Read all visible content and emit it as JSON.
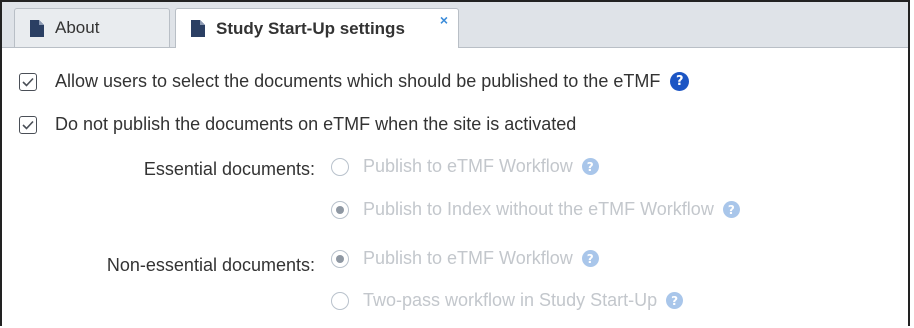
{
  "tabs": [
    {
      "label": "About",
      "icon": "document-icon",
      "active": false
    },
    {
      "label": "Study Start-Up settings",
      "icon": "document-icon",
      "active": true,
      "close_glyph": "×"
    }
  ],
  "options": {
    "allow_select": {
      "label": "Allow users to select the documents which should be published to the eTMF",
      "checked": true
    },
    "do_not_publish": {
      "label": "Do not publish the documents on eTMF when the site is activated",
      "checked": true
    }
  },
  "essential": {
    "label": "Essential documents:",
    "choices": [
      {
        "label": "Publish to eTMF Workflow",
        "selected": false
      },
      {
        "label": "Publish to Index without the eTMF Workflow",
        "selected": true
      }
    ]
  },
  "non_essential": {
    "label": "Non-essential documents:",
    "choices": [
      {
        "label": "Publish to eTMF Workflow",
        "selected": true
      },
      {
        "label": "Two-pass workflow in Study Start-Up",
        "selected": false
      }
    ]
  },
  "help_glyph": "?",
  "colors": {
    "accent": "#1c55c4",
    "help_disabled": "#a9c6ea",
    "tab_close": "#3a8bd9",
    "disabled_text": "#c3c7cc"
  }
}
